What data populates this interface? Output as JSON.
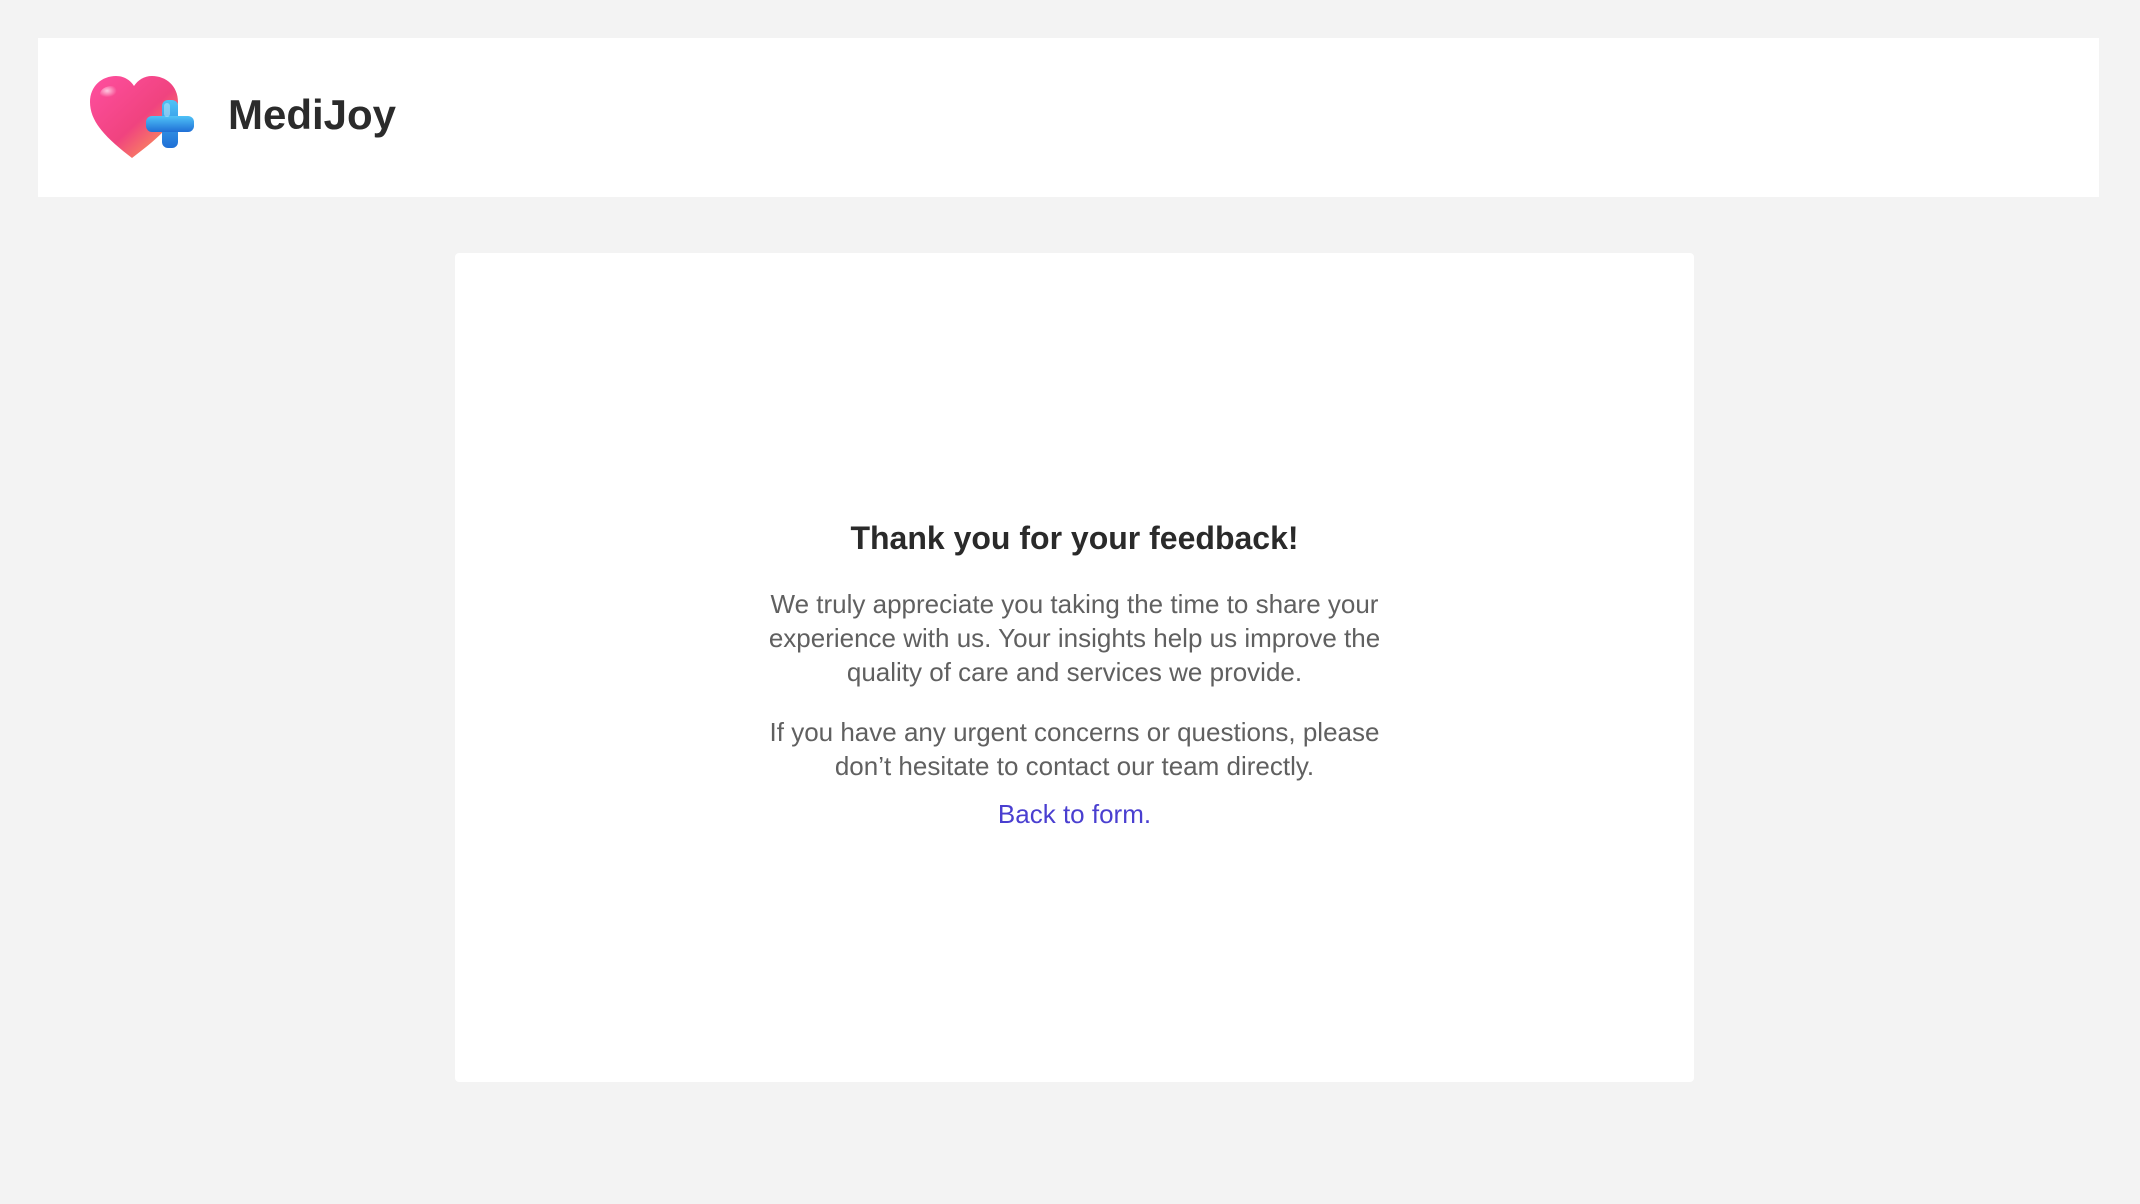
{
  "header": {
    "brand_name": "MediJoy",
    "logo_icon": "heart-plus-icon"
  },
  "confirmation": {
    "title": "Thank you for your feedback!",
    "paragraph_1": "We truly appreciate you taking the time to share your experience with us. Your insights help us improve the quality of care and services we provide.",
    "paragraph_2": "If you have any urgent concerns or questions, please don’t hesitate to contact our team directly.",
    "back_link_label": "Back to form."
  },
  "colors": {
    "page_background": "#f3f3f3",
    "surface": "#ffffff",
    "link": "#4a3fd0",
    "heart_pink": "#f0437f",
    "heart_orange": "#ffb14a",
    "plus_blue": "#2e8fe0"
  }
}
